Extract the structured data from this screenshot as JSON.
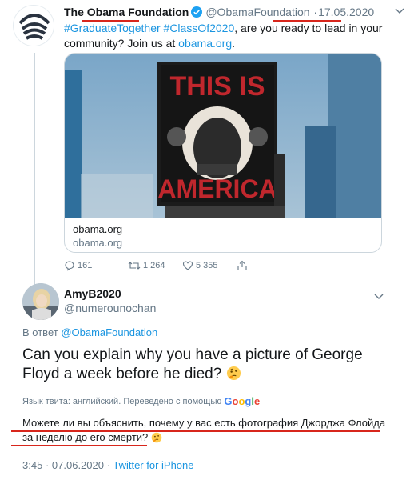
{
  "original_tweet": {
    "author_name": "The Obama Foundation",
    "author_handle": "@ObamaFoundation",
    "separator": "·",
    "date": "17.05.2020",
    "hashtag_1": "#GraduateTogether",
    "hashtag_2": "#ClassOf2020",
    "text_middle": ", are you ready to lead in your community? Join us at ",
    "text_link": "obama.org",
    "text_end": ".",
    "card": {
      "image_sign_line_1": "THIS IS",
      "image_sign_line_2": "AMERICA",
      "title": "obama.org",
      "subtitle": "obama.org"
    },
    "actions": {
      "replies": "161",
      "retweets": "1 264",
      "likes": "5 355"
    }
  },
  "reply_tweet": {
    "author_name": "AmyB2020",
    "author_handle": "@numerounochan",
    "reply_to_prefix": "В ответ",
    "reply_to_handle": "@ObamaFoundation",
    "text": "Can you explain why you have a picture of George Floyd a week before he died?",
    "translation_note": "Язык твита: английский. Переведено с помощью",
    "translation_service": "Google",
    "translated_line_1": "Можете ли вы объяснить, почему у вас есть фотография Джорджа Флойда",
    "translated_line_2": "за неделю до его смерти?",
    "time": "3:45",
    "date": "07.06.2020",
    "source": "Twitter for iPhone",
    "meta_separator": "·"
  },
  "colors": {
    "link": "#1b95e0",
    "muted": "#657786",
    "annotation_red": "#d8261c",
    "sign_red": "#c0272d"
  },
  "icons": [
    "verified-badge-icon",
    "chevron-down-icon",
    "reply-icon",
    "retweet-icon",
    "like-icon",
    "share-icon",
    "thinking-face-icon"
  ]
}
